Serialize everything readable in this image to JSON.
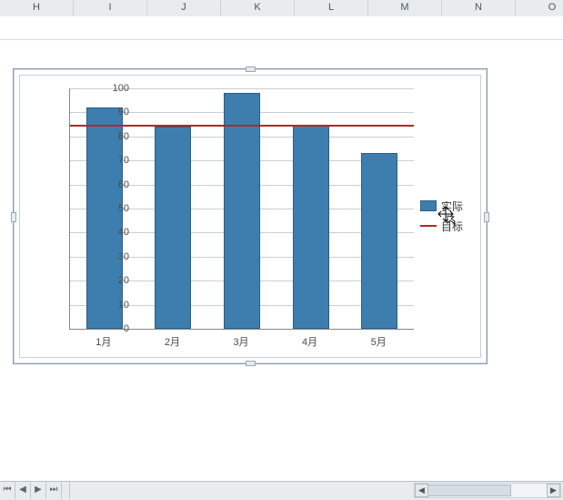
{
  "columns": [
    "H",
    "I",
    "J",
    "K",
    "L",
    "M",
    "N",
    "O"
  ],
  "legend": {
    "series1": "实际",
    "series2": "目标"
  },
  "chart_data": {
    "type": "bar",
    "categories": [
      "1月",
      "2月",
      "3月",
      "4月",
      "5月"
    ],
    "series": [
      {
        "name": "实际",
        "values": [
          92,
          84,
          98,
          85,
          73
        ]
      },
      {
        "name": "目标",
        "values": [
          85,
          85,
          85,
          85,
          85
        ]
      }
    ],
    "ylim": [
      0,
      100
    ],
    "ytick_step": 10,
    "title": "",
    "xlabel": "",
    "ylabel": ""
  },
  "colors": {
    "bar_fill": "#3d7eae",
    "bar_stroke": "#2a5f86",
    "target_line": "#b22727",
    "grid": "#c7cfd7"
  }
}
